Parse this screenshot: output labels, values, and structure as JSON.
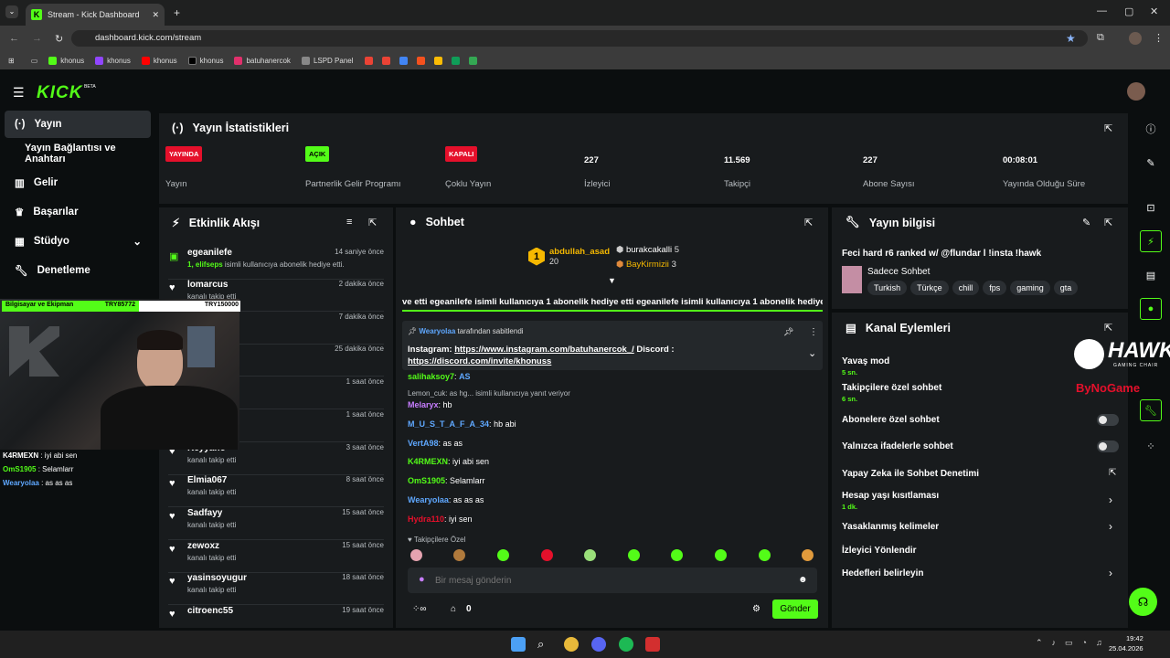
{
  "browser": {
    "tab_title": "Stream - Kick Dashboard",
    "url": "dashboard.kick.com/stream",
    "bookmarks": [
      "khonus",
      "khonus",
      "khonus",
      "khonus",
      "batuhanercok",
      "LSPD Panel"
    ]
  },
  "brand": {
    "logo": "KICK",
    "beta": "BETA",
    "accent": "#53fc18"
  },
  "sidebar": {
    "items": [
      {
        "label": "Yayın",
        "icon": "broadcast-icon"
      },
      {
        "label": "Yayın Bağlantısı ve Anahtarı"
      },
      {
        "label": "Gelir",
        "icon": "chart-icon"
      },
      {
        "label": "Başarılar",
        "icon": "trophy-icon"
      },
      {
        "label": "Stüdyo",
        "icon": "studio-icon"
      },
      {
        "label": "Denetleme",
        "icon": "wrench-icon"
      }
    ]
  },
  "stats": {
    "title": "Yayın İstatistikleri",
    "items": [
      {
        "badge": "YAYINDA",
        "label": "Yayın",
        "color": "#e5102b"
      },
      {
        "badge": "AÇIK",
        "label": "Partnerlik Gelir Programı",
        "color": "#53fc18"
      },
      {
        "badge": "KAPALI",
        "label": "Çoklu Yayın",
        "color": "#e5102b"
      },
      {
        "value": "227",
        "label": "İzleyici"
      },
      {
        "value": "11.569",
        "label": "Takipçi"
      },
      {
        "value": "227",
        "label": "Abone Sayısı"
      },
      {
        "value": "00:08:01",
        "label": "Yayında Olduğu Süre"
      }
    ]
  },
  "activity": {
    "title": "Etkinlik Akışı",
    "events": [
      {
        "name": "egeanilefe",
        "time": "14 saniye önce",
        "sub_user": "1, elifseps",
        "sub": " isimli kullanıcıya abonelik hediye etti."
      },
      {
        "name": "lomarcus",
        "time": "2 dakika önce",
        "sub": "kanalı takip etti"
      },
      {
        "name": "",
        "time": "7 dakika önce",
        "sub": ""
      },
      {
        "name": "",
        "time": "25 dakika önce",
        "sub": ""
      },
      {
        "name": "",
        "time": "1 saat önce",
        "sub": ""
      },
      {
        "name": "",
        "time": "1 saat önce",
        "sub": ""
      },
      {
        "name": "Keyyano",
        "time": "3 saat önce",
        "sub": "kanalı takip etti"
      },
      {
        "name": "Elmia067",
        "time": "8 saat önce",
        "sub": "kanalı takip etti"
      },
      {
        "name": "Sadfayy",
        "time": "15 saat önce",
        "sub": "kanalı takip etti"
      },
      {
        "name": "zewoxz",
        "time": "15 saat önce",
        "sub": "kanalı takip etti"
      },
      {
        "name": "yasinsoyugur",
        "time": "18 saat önce",
        "sub": "kanalı takip etti"
      },
      {
        "name": "citroenc55",
        "time": "19 saat önce",
        "sub": ""
      }
    ]
  },
  "chat": {
    "title": "Sohbet",
    "top_gifters": [
      {
        "rank": "1",
        "name": "abdullah_asad",
        "count": "20"
      },
      {
        "name": "burakcakalli",
        "count": "5"
      },
      {
        "name": "BayKirmizii",
        "count": "3"
      }
    ],
    "ticker": "ve etti   egeanilefe isimli kullanıcıya 1 abonelik hediye etti   egeanilefe isimli kullanıcıya 1 abonelik hediye etti",
    "pinned_by": "Wearyolaa",
    "pinned_by_suffix": "tarafından sabitlendi",
    "pinned_text_a": "Instagram: ",
    "pinned_link_a": "https://www.instagram.com/batuhanercok_/",
    "pinned_text_b": " Discord : ",
    "pinned_link_b": "https://discord.com/invite/khonuss",
    "messages": [
      {
        "user": "salihaksoy7",
        "text": " ",
        "color": "#53fc18"
      },
      {
        "user": "",
        "text": "Lemon_cuk: as hg... isimli kullanıcıya yanıt veriyor",
        "color": "#b9bec2"
      },
      {
        "user": "Melaryx",
        "text": "hb",
        "color": "#c77dff"
      },
      {
        "user": "M_U_S_T_A_F_A_34",
        "text": "hb abi",
        "color": "#5fa8ff"
      },
      {
        "user": "VertA98",
        "text": "as as",
        "color": "#5fa8ff"
      },
      {
        "user": "K4RMEXN",
        "text": "iyi abi sen",
        "color": "#53fc18"
      },
      {
        "user": "OmS1905",
        "text": "Selamlarr",
        "color": "#53fc18"
      },
      {
        "user": "Wearyolaa",
        "text": "as as as",
        "color": "#5fa8ff"
      },
      {
        "user": "Hydra110",
        "text": "iyi sen",
        "color": "#e5102b"
      }
    ],
    "emote_label": "Takipçilere Özel",
    "input_placeholder": "Bir mesaj gönderin",
    "points": "0",
    "send": "Gönder"
  },
  "stream_info": {
    "title": "Yayın bilgisi",
    "stream_title": "Feci hard r6 ranked w/ @flundar l !insta !hawk",
    "category": "Sadece Sohbet",
    "tags": [
      "Turkish",
      "Türkçe",
      "chill",
      "fps",
      "gaming",
      "gta"
    ]
  },
  "channel_actions": {
    "title": "Kanal Eylemleri",
    "items": [
      {
        "label": "Yavaş mod",
        "sub": "5 sn."
      },
      {
        "label": "Takipçilere özel sohbet",
        "sub": "6 sn."
      },
      {
        "label": "Abonelere özel sohbet",
        "sub": ""
      },
      {
        "label": "Yalnızca ifadelerle sohbet",
        "sub": ""
      },
      {
        "label": "Yapay Zeka ile Sohbet Denetimi",
        "sub": ""
      },
      {
        "label": "Hesap yaşı kısıtlaması",
        "sub": "1 dk."
      },
      {
        "label": "Yasaklanmış kelimeler",
        "sub": ""
      },
      {
        "label": "İzleyici Yönlendir",
        "sub": ""
      },
      {
        "label": "Hedefleri belirleyin",
        "sub": ""
      }
    ]
  },
  "overlay": {
    "cam_header_left": "Bilgisayar ve Ekipman",
    "cam_header_mid": "TRY85772",
    "cam_header_right": "TRY150000",
    "cam_chat": [
      {
        "user": "K4RMEXN",
        "text": " : iyi abi sen"
      },
      {
        "user": "OmS1905",
        "text": " : Selamlarr"
      },
      {
        "user": "Wearyolaa",
        "text": " : as as as"
      }
    ],
    "hawk": "HAWK",
    "hawk_sub": "GAMING CHAIR",
    "buyoga": "ByNoGame"
  },
  "taskbar": {
    "time": "19:42",
    "date": "25.04.2026"
  }
}
